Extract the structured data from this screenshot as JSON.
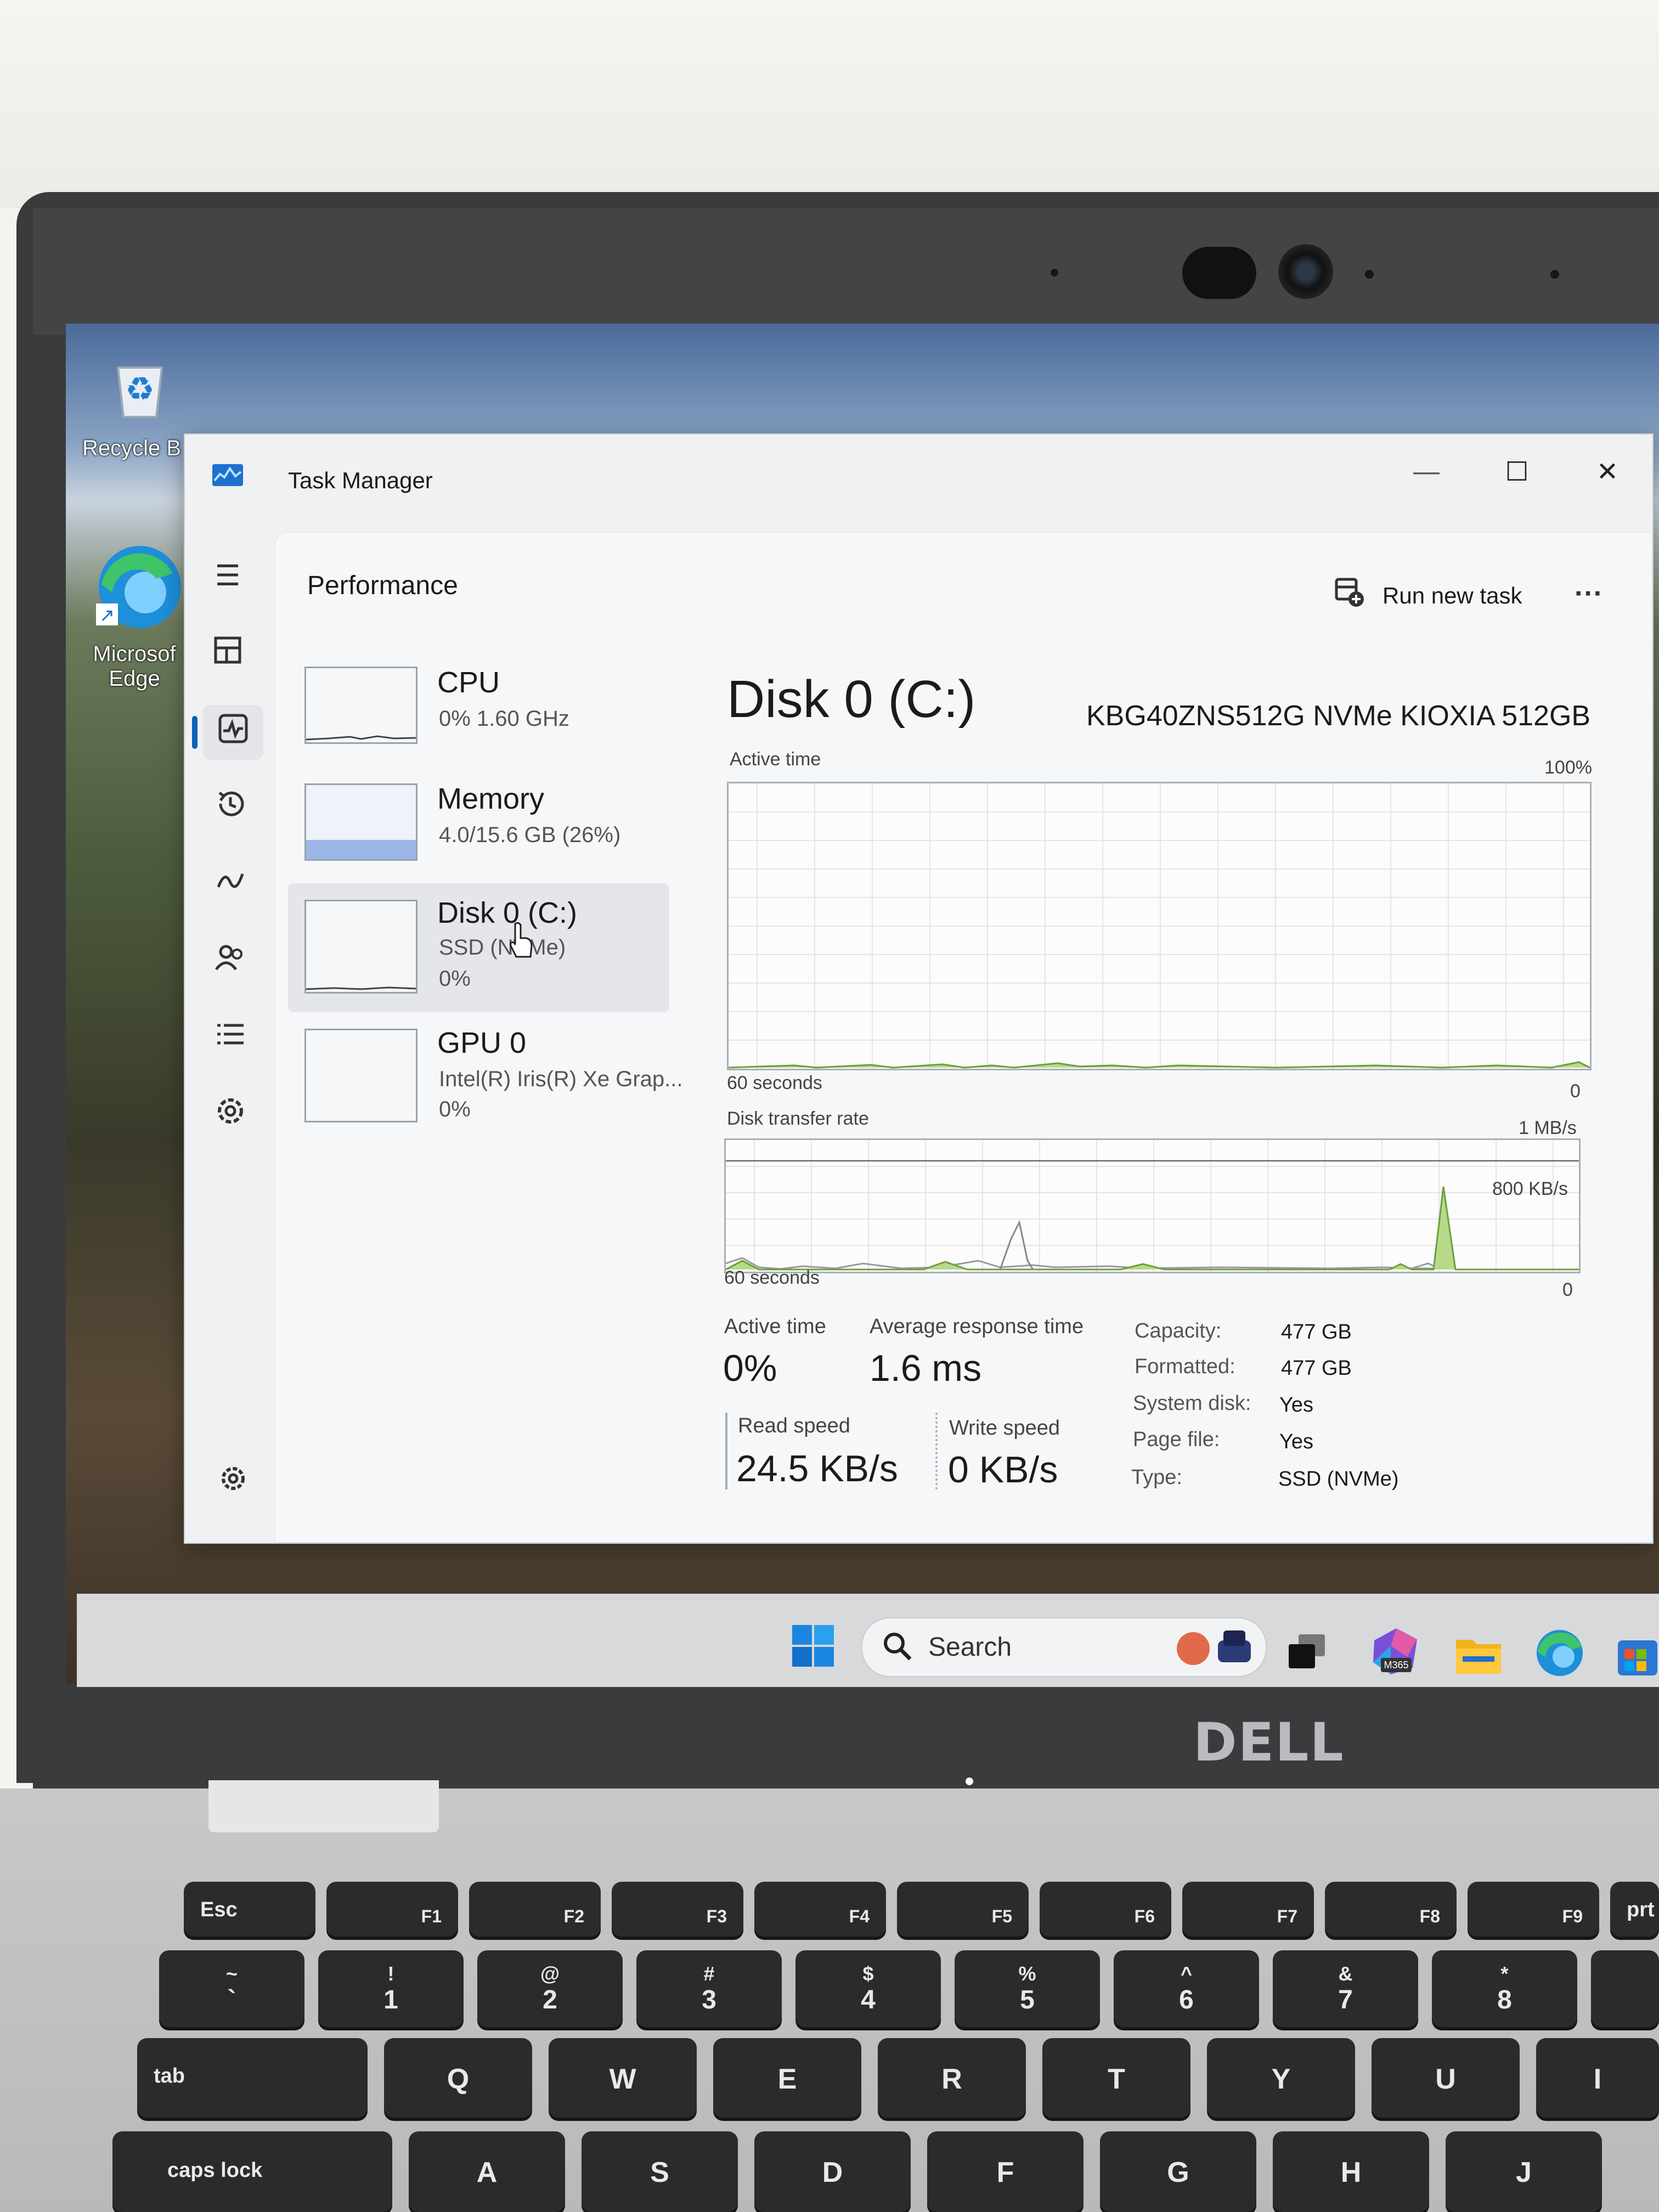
{
  "desktop": {
    "icons": [
      {
        "label": "Recycle B"
      },
      {
        "label": "Microsof Edge"
      }
    ]
  },
  "window": {
    "title": "Task Manager",
    "controls": {
      "minimize": "—",
      "maximize": "☐",
      "close": "✕"
    }
  },
  "header": {
    "page_title": "Performance",
    "run_new_task": "Run new task",
    "more": "···"
  },
  "sidebar": {
    "items": [
      {
        "name": "CPU",
        "line1": "0%  1.60 GHz",
        "line2": ""
      },
      {
        "name": "Memory",
        "line1": "4.0/15.6 GB (26%)",
        "line2": ""
      },
      {
        "name": "Disk 0 (C:)",
        "line1": "SSD (NVMe)",
        "line2": "0%"
      },
      {
        "name": "GPU 0",
        "line1": "Intel(R) Iris(R) Xe Grap...",
        "line2": "0%"
      }
    ]
  },
  "detail": {
    "title": "Disk 0 (C:)",
    "model": "KBG40ZNS512G NVMe KIOXIA 512GB",
    "active_graph": {
      "label": "Active time",
      "max": "100%",
      "time": "60 seconds",
      "min": "0"
    },
    "transfer_graph": {
      "label": "Disk transfer rate",
      "max": "1 MB/s",
      "mid": "800 KB/s",
      "time": "60 seconds",
      "min": "0"
    },
    "stats": {
      "active_time_label": "Active time",
      "active_time_value": "0%",
      "avg_response_label": "Average response time",
      "avg_response_value": "1.6 ms",
      "read_label": "Read speed",
      "read_value": "24.5 KB/s",
      "write_label": "Write speed",
      "write_value": "0 KB/s"
    },
    "properties": [
      {
        "label": "Capacity:",
        "value": "477 GB"
      },
      {
        "label": "Formatted:",
        "value": "477 GB"
      },
      {
        "label": "System disk:",
        "value": "Yes"
      },
      {
        "label": "Page file:",
        "value": "Yes"
      },
      {
        "label": "Type:",
        "value": "SSD (NVMe)"
      }
    ]
  },
  "taskbar": {
    "search": "Search",
    "badge": "M365"
  },
  "laptop": {
    "brand": "DELL"
  },
  "keyboard": {
    "fn_row": [
      {
        "main": "Esc",
        "fn": ""
      },
      {
        "main": "",
        "fn": "F1"
      },
      {
        "main": "",
        "fn": "F2"
      },
      {
        "main": "",
        "fn": "F3"
      },
      {
        "main": "",
        "fn": "F4"
      },
      {
        "main": "",
        "fn": "F5"
      },
      {
        "main": "",
        "fn": "F6"
      },
      {
        "main": "",
        "fn": "F7"
      },
      {
        "main": "",
        "fn": "F8"
      },
      {
        "main": "",
        "fn": "F9"
      },
      {
        "main": "prt",
        "fn": ""
      }
    ],
    "num_row": [
      {
        "up": "~",
        "dn": "`"
      },
      {
        "up": "!",
        "dn": "1"
      },
      {
        "up": "@",
        "dn": "2"
      },
      {
        "up": "#",
        "dn": "3"
      },
      {
        "up": "$",
        "dn": "4"
      },
      {
        "up": "%",
        "dn": "5"
      },
      {
        "up": "^",
        "dn": "6"
      },
      {
        "up": "&",
        "dn": "7"
      },
      {
        "up": "*",
        "dn": "8"
      }
    ],
    "q_row": [
      "tab",
      "Q",
      "W",
      "E",
      "R",
      "T",
      "Y",
      "U",
      "I"
    ],
    "a_row": [
      "caps lock",
      "A",
      "S",
      "D",
      "F",
      "G",
      "H",
      "J"
    ]
  },
  "colors": {
    "accent": "#0a5fb8",
    "memory_fill": "#9ab6e6",
    "disk_green": "#8fc64a",
    "window_bg": "#f0f1f2"
  }
}
